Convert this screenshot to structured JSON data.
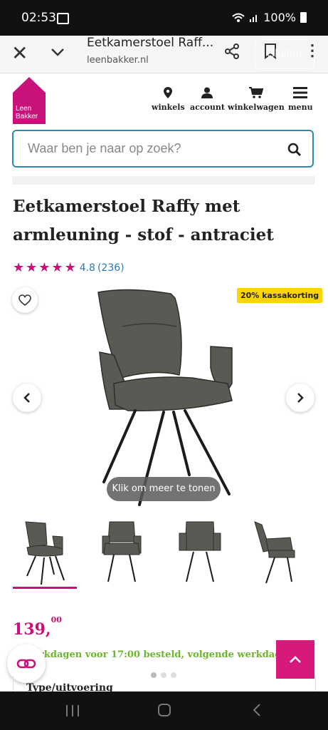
{
  "status_bar": {
    "time": "02:53",
    "battery": "100%"
  },
  "browser": {
    "page_title": "Eetkamerstoel Raff...",
    "url": "leenbakker.nl",
    "close_label": "Sluiten"
  },
  "header": {
    "logo_line1": "Leen",
    "logo_line2": "Bakker",
    "nav": [
      {
        "label": "winkels",
        "icon": "location-pin-icon"
      },
      {
        "label": "account",
        "icon": "user-icon"
      },
      {
        "label": "winkelwagen",
        "icon": "cart-icon"
      },
      {
        "label": "menu",
        "icon": "hamburger-menu-icon"
      }
    ]
  },
  "search": {
    "placeholder": "Waar ben je naar op zoek?"
  },
  "product": {
    "title": "Eetkamerstoel Raffy met armleuning - stof - antraciet",
    "rating_value": "4.8",
    "review_count": "(236)",
    "stars": 5,
    "discount_badge": "20% kassakorting",
    "image_tooltip": "Klik om meer te tonen",
    "price_main": "139,",
    "price_cents": "00",
    "delivery_text": "rkdagen voor 17:00 besteld, volgende werkdag in",
    "type_label": "Type/uitvoering"
  },
  "colors": {
    "brand_magenta": "#c8117a",
    "search_border": "#2a8bb5",
    "discount_yellow": "#ffd500",
    "delivery_green": "#6db52d",
    "chair_fabric": "#5b5953"
  }
}
